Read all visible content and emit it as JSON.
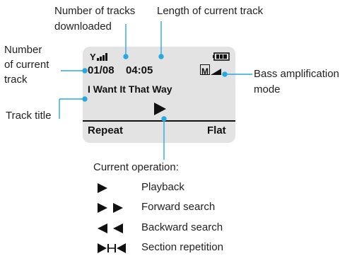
{
  "callouts": {
    "tracks_downloaded": "Number of tracks downloaded",
    "tracks_downloaded_l1": "Number of tracks",
    "tracks_downloaded_l2": "downloaded",
    "track_length": "Length of current track",
    "current_track_l1": "Number",
    "current_track_l2": "of current",
    "current_track_l3": "track",
    "track_title": "Track title",
    "bass_l1": "Bass amplification",
    "bass_l2": "mode",
    "current_operation": "Current operation:"
  },
  "screen": {
    "counter": "01/08",
    "time": "04:05",
    "mode_badge": "M",
    "title": "I Want It That Way",
    "repeat": "Repeat",
    "eq": "Flat"
  },
  "operations": [
    {
      "icon": "play-icon",
      "label": "Playback"
    },
    {
      "icon": "forward-search-icon",
      "label": "Forward search"
    },
    {
      "icon": "backward-search-icon",
      "label": "Backward search"
    },
    {
      "icon": "section-repeat-icon",
      "label": "Section repetition"
    }
  ],
  "colors": {
    "callout_line": "#29a8e0",
    "screen_bg": "#e3e3e3",
    "text": "#111111"
  }
}
